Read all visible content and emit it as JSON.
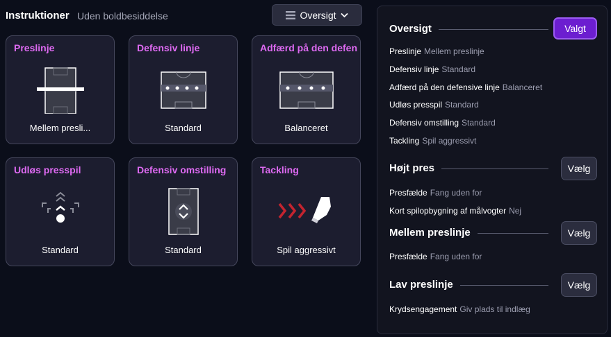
{
  "header": {
    "title": "Instruktioner",
    "subtitle": "Uden boldbesiddelse",
    "dropdown_label": "Oversigt",
    "dropdown_icon": "list-icon",
    "chevron_icon": "chevron-down-icon"
  },
  "cards": [
    {
      "title": "Preslinje",
      "value": "Mellem presli...",
      "icon": "pitch-line-icon"
    },
    {
      "title": "Defensiv linje",
      "value": "Standard",
      "icon": "defensive-line-icon"
    },
    {
      "title": "Adfærd på den defensi",
      "value": "Balanceret",
      "icon": "defensive-behaviour-icon"
    },
    {
      "title": "Udløs presspil",
      "value": "Standard",
      "icon": "press-trigger-icon"
    },
    {
      "title": "Defensiv omstilling",
      "value": "Standard",
      "icon": "transition-icon"
    },
    {
      "title": "Tackling",
      "value": "Spil aggressivt",
      "icon": "tackle-boot-icon"
    }
  ],
  "panel": {
    "oversigt": {
      "title": "Oversigt",
      "button": "Valgt",
      "rows": [
        {
          "k": "Preslinje",
          "v": "Mellem preslinje"
        },
        {
          "k": "Defensiv linje",
          "v": "Standard"
        },
        {
          "k": "Adfærd på den defensive linje",
          "v": "Balanceret"
        },
        {
          "k": "Udløs presspil",
          "v": "Standard"
        },
        {
          "k": "Defensiv omstilling",
          "v": "Standard"
        },
        {
          "k": "Tackling",
          "v": "Spil aggressivt"
        }
      ]
    },
    "hojt": {
      "title": "Højt pres",
      "button": "Vælg",
      "rows": [
        {
          "k": "Presfælde",
          "v": "Fang uden for"
        },
        {
          "k": "Kort spilopbygning af målvogter",
          "v": "Nej"
        }
      ]
    },
    "mellem": {
      "title": "Mellem preslinje",
      "button": "Vælg",
      "rows": [
        {
          "k": "Presfælde",
          "v": "Fang uden for"
        }
      ]
    },
    "lav": {
      "title": "Lav preslinje",
      "button": "Vælg",
      "rows": [
        {
          "k": "Krydsengagement",
          "v": "Giv plads til indlæg"
        }
      ]
    }
  },
  "colors": {
    "accent": "#de6af2",
    "selected": "#6c1ed0",
    "arrows": "#c4242f"
  }
}
